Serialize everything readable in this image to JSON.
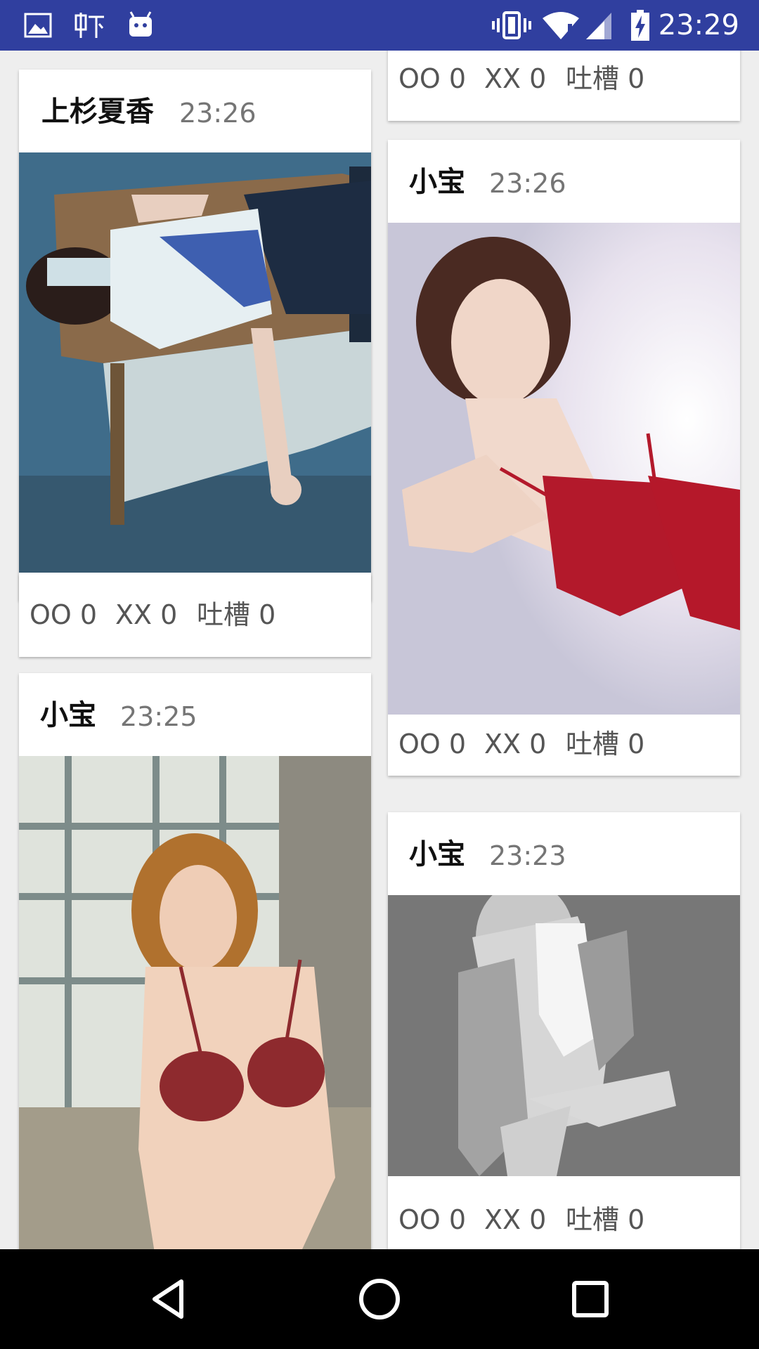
{
  "status_bar": {
    "time": "23:29",
    "left_icons": [
      "image-icon",
      "xia-app-icon",
      "android-robot-icon"
    ],
    "right_icons": [
      "vibrate-icon",
      "wifi-alert-icon",
      "cell-signal-icon",
      "battery-charging-icon"
    ],
    "background": "#303f9f"
  },
  "feed": {
    "cards": [
      {
        "author": "上杉夏香",
        "time": "23:26",
        "oo": "OO 0",
        "xx": "XX 0",
        "tucao": "吐槽 0"
      },
      {
        "oo": "OO 0",
        "xx": "XX 0",
        "tucao": "吐槽 0"
      },
      {
        "author": "小宝",
        "time": "23:26",
        "oo": "OO 0",
        "xx": "XX 0",
        "tucao": "吐槽 0"
      },
      {
        "author": "小宝",
        "time": "23:25"
      },
      {
        "author": "小宝",
        "time": "23:23",
        "oo": "OO 0",
        "xx": "XX 0",
        "tucao": "吐槽 0"
      }
    ]
  },
  "nav_bar": {
    "buttons": [
      "back-icon",
      "home-icon",
      "recents-icon"
    ]
  }
}
